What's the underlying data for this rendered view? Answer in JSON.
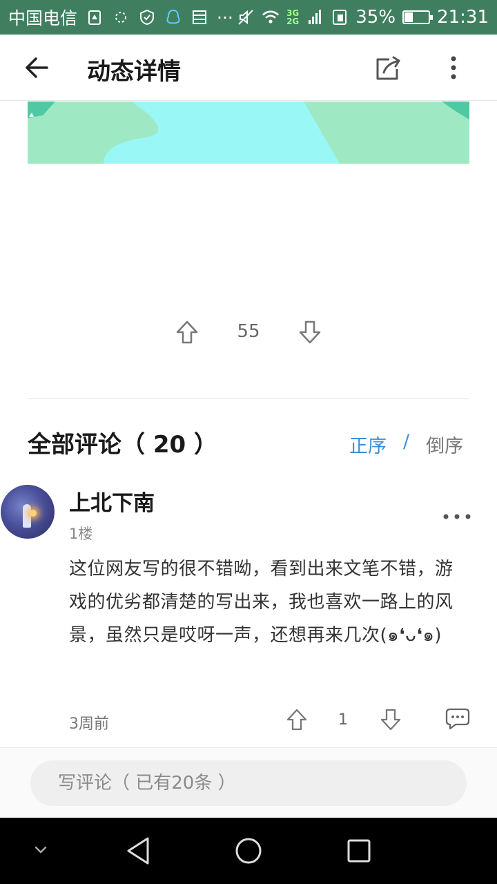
{
  "status_bar": {
    "carrier": "中国电信",
    "battery_percent": "35%",
    "battery_level": 0.35,
    "time": "21:31",
    "network_top": "3G",
    "network_bottom": "2G"
  },
  "header": {
    "title": "动态详情"
  },
  "post": {
    "vote_count": "55"
  },
  "comments": {
    "title": "全部评论（ 20 ）",
    "sort_asc": "正序",
    "sort_sep": "/",
    "sort_desc": "倒序",
    "items": [
      {
        "name": "上北下南",
        "floor": "1楼",
        "text": "这位网友写的很不错呦，看到出来文笔不错，游戏的优劣都清楚的写出来，我也喜欢一路上的风景，虽然只是哎呀一声，还想再来几次(๑❛ᴗ❛๑)",
        "time": "3周前",
        "likes": "1"
      }
    ]
  },
  "comment_bar": {
    "placeholder": "写评论（ 已有20条 ）"
  },
  "colors": {
    "status_bar": "#3f7f60",
    "accent": "#3b8fd9",
    "image_green": "#9fe8c4",
    "image_cyan": "#99f7f5"
  }
}
